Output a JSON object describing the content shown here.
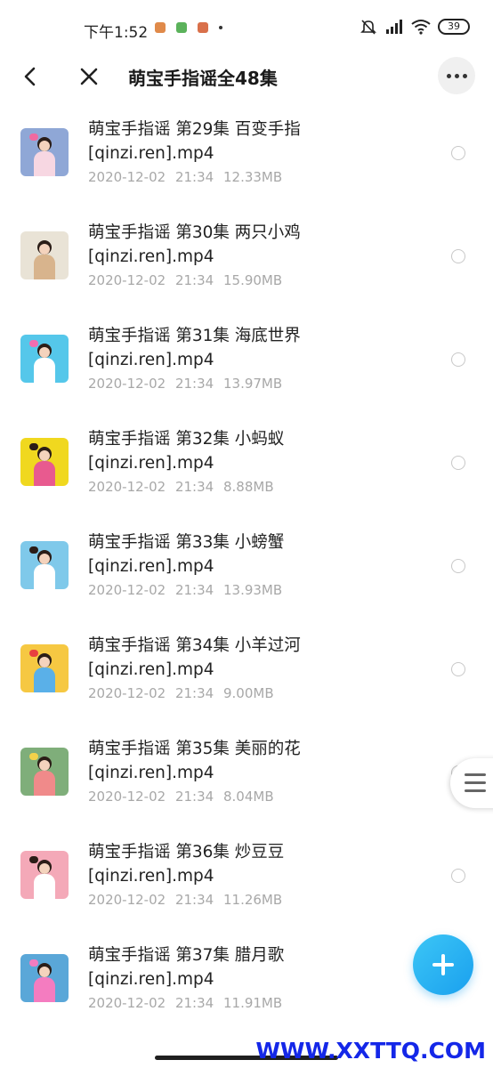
{
  "status_bar": {
    "time": "下午1:52",
    "battery": "39",
    "app_icon_colors": [
      "#e08a4a",
      "#5bb25b",
      "#d9704a",
      "#333333"
    ]
  },
  "header": {
    "title": "萌宝手指谣全48集",
    "back_icon": "chevron-left-icon",
    "close_icon": "close-icon",
    "more_icon": "more-horizontal-icon"
  },
  "files": [
    {
      "line1": "萌宝手指谣 第29集 百变手指",
      "line2": "[qinzi.ren].mp4",
      "date": "2020-12-02",
      "time": "21:34",
      "size": "12.33MB",
      "thumb_bg": "#8fa7d6",
      "thumb_body": "#f7d7e2",
      "thumb_bow": "#f06aa0"
    },
    {
      "line1": "萌宝手指谣 第30集 两只小鸡",
      "line2": "[qinzi.ren].mp4",
      "date": "2020-12-02",
      "time": "21:34",
      "size": "15.90MB",
      "thumb_bg": "#e9e3d6",
      "thumb_body": "#d8b48d",
      "thumb_bow": "#e9e3d6"
    },
    {
      "line1": "萌宝手指谣 第31集 海底世界",
      "line2": "[qinzi.ren].mp4",
      "date": "2020-12-02",
      "time": "21:34",
      "size": "13.97MB",
      "thumb_bg": "#55c7ea",
      "thumb_body": "#ffffff",
      "thumb_bow": "#f26db0"
    },
    {
      "line1": "萌宝手指谣 第32集 小蚂蚁",
      "line2": "[qinzi.ren].mp4",
      "date": "2020-12-02",
      "time": "21:34",
      "size": "8.88MB",
      "thumb_bg": "#f0d81f",
      "thumb_body": "#e85a8f",
      "thumb_bow": "#2b1d17"
    },
    {
      "line1": "萌宝手指谣 第33集 小螃蟹",
      "line2": "[qinzi.ren].mp4",
      "date": "2020-12-02",
      "time": "21:34",
      "size": "13.93MB",
      "thumb_bg": "#7fc9ea",
      "thumb_body": "#ffffff",
      "thumb_bow": "#2b1d17"
    },
    {
      "line1": "萌宝手指谣 第34集 小羊过河",
      "line2": "[qinzi.ren].mp4",
      "date": "2020-12-02",
      "time": "21:34",
      "size": "9.00MB",
      "thumb_bg": "#f6c842",
      "thumb_body": "#5ab0e8",
      "thumb_bow": "#e84040"
    },
    {
      "line1": "萌宝手指谣 第35集 美丽的花",
      "line2": "[qinzi.ren].mp4",
      "date": "2020-12-02",
      "time": "21:34",
      "size": "8.04MB",
      "thumb_bg": "#7fae7a",
      "thumb_body": "#f08a8a",
      "thumb_bow": "#f3d24a"
    },
    {
      "line1": "萌宝手指谣 第36集 炒豆豆",
      "line2": "[qinzi.ren].mp4",
      "date": "2020-12-02",
      "time": "21:34",
      "size": "11.26MB",
      "thumb_bg": "#f4a9b8",
      "thumb_body": "#ffffff",
      "thumb_bow": "#2b1d17"
    },
    {
      "line1": "萌宝手指谣 第37集 腊月歌",
      "line2": "[qinzi.ren].mp4",
      "date": "2020-12-02",
      "time": "21:34",
      "size": "11.91MB",
      "thumb_bg": "#5aa7d8",
      "thumb_body": "#f47cc0",
      "thumb_bow": "#f47cc0"
    }
  ],
  "fab_icon": "plus-icon",
  "side_handle_icon": "menu-icon",
  "watermark": "WWW.XXTTQ.COM"
}
